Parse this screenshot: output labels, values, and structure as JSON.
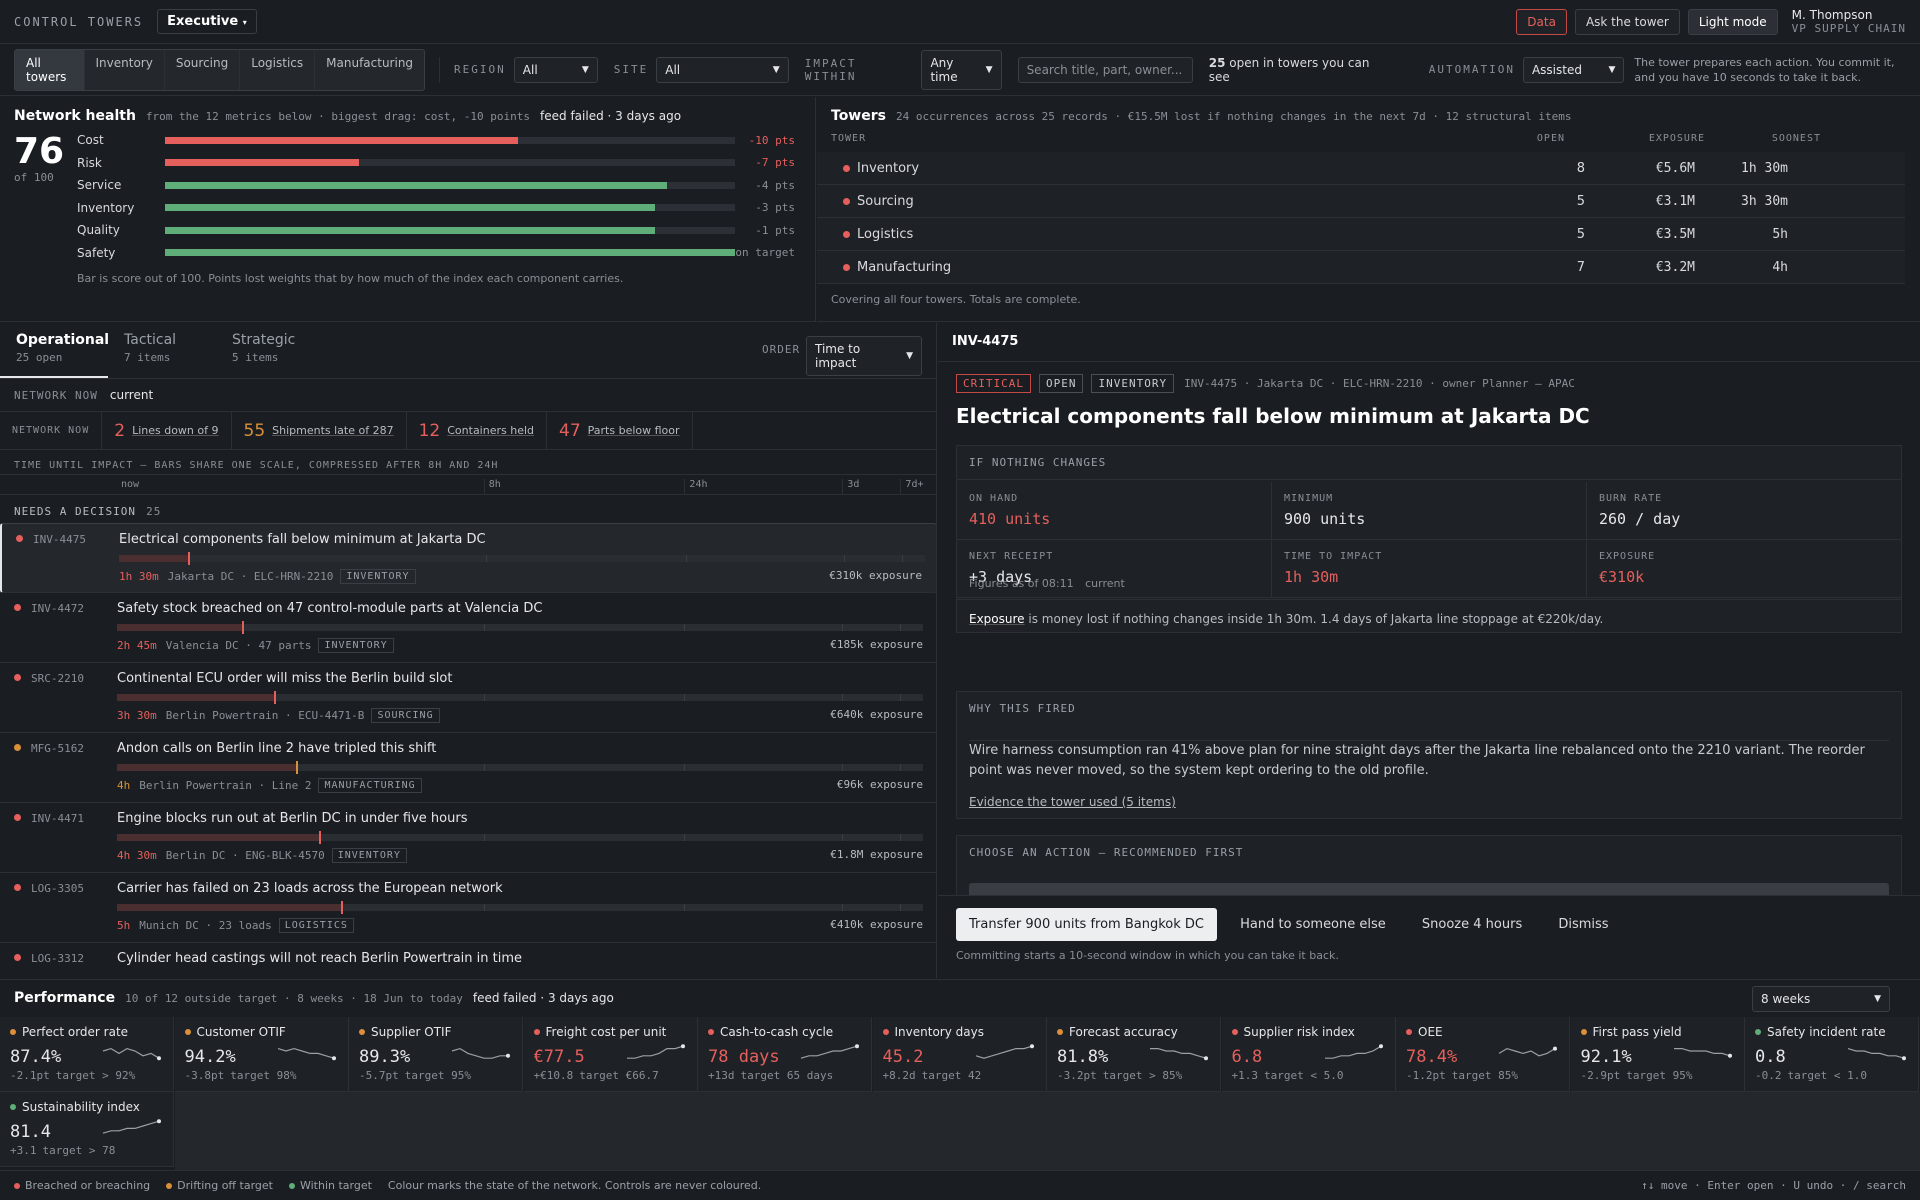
{
  "app": {
    "title": "CONTROL TOWERS",
    "scope": "Executive"
  },
  "top": {
    "data": "Data",
    "ask": "Ask the tower",
    "mode": "Light mode",
    "user_name": "M. Thompson",
    "user_role": "VP SUPPLY CHAIN"
  },
  "filters": {
    "towers": [
      "All towers",
      "Inventory",
      "Sourcing",
      "Logistics",
      "Manufacturing"
    ],
    "region_label": "REGION",
    "region": "All",
    "site_label": "SITE",
    "site": "All",
    "impact_label": "IMPACT WITHIN",
    "impact": "Any time",
    "search_placeholder": "Search title, part, owner...",
    "open_count": "25",
    "open_text": "open in towers you can see",
    "automation_label": "AUTOMATION",
    "automation": "Assisted",
    "automation_note": "The tower prepares each action. You commit it, and you have 10 seconds to take it back."
  },
  "health": {
    "title": "Network health",
    "subtitle": "from the 12 metrics below · biggest drag: cost, -10 points",
    "feed": "feed failed · 3 days ago",
    "score": "76",
    "of": "of 100",
    "note": "Bar is score out of 100. Points lost weights that by how much of the index each component carries.",
    "rows": [
      {
        "name": "Cost",
        "score": 62,
        "pts": "-10 pts",
        "status": "red"
      },
      {
        "name": "Risk",
        "score": 34,
        "pts": "-7 pts",
        "status": "red"
      },
      {
        "name": "Service",
        "score": 88,
        "pts": "-4 pts",
        "status": "green"
      },
      {
        "name": "Inventory",
        "score": 86,
        "pts": "-3 pts",
        "status": "green"
      },
      {
        "name": "Quality",
        "score": 86,
        "pts": "-1 pts",
        "status": "green"
      },
      {
        "name": "Safety",
        "score": 100,
        "pts": "on target",
        "status": "green"
      }
    ]
  },
  "towers": {
    "title": "Towers",
    "subtitle": "24 occurrences across 25 records · €15.5M lost if nothing changes in the next 7d · 12 structural items",
    "col_tower": "TOWER",
    "col_open": "OPEN",
    "col_exposure": "EXPOSURE",
    "col_soonest": "SOONEST",
    "footnote": "Covering all four towers. Totals are complete.",
    "rows": [
      {
        "name": "Inventory",
        "open": "8",
        "exposure": "€5.6M",
        "soonest": "1h 30m"
      },
      {
        "name": "Sourcing",
        "open": "5",
        "exposure": "€3.1M",
        "soonest": "3h 30m"
      },
      {
        "name": "Logistics",
        "open": "5",
        "exposure": "€3.5M",
        "soonest": "5h"
      },
      {
        "name": "Manufacturing",
        "open": "7",
        "exposure": "€3.2M",
        "soonest": "4h"
      }
    ]
  },
  "queue": {
    "tabs": [
      {
        "label": "Operational",
        "sub": "25 open"
      },
      {
        "label": "Tactical",
        "sub": "7 items"
      },
      {
        "label": "Strategic",
        "sub": "5 items"
      }
    ],
    "order_label": "ORDER",
    "order": "Time to impact",
    "netnow_label": "NETWORK NOW",
    "netnow_value": "current",
    "stats_label": "NETWORK NOW",
    "stats": [
      {
        "v": "2",
        "l": "Lines down of 9"
      },
      {
        "v": "55",
        "l": "Shipments late of 287"
      },
      {
        "v": "12",
        "l": "Containers held"
      },
      {
        "v": "47",
        "l": "Parts below floor"
      }
    ],
    "scale_caption": "TIME UNTIL IMPACT — BARS SHARE ONE SCALE, COMPRESSED AFTER 8H AND 24H",
    "scale_ticks": [
      "now",
      "8h",
      "24h",
      "3d",
      "7d+"
    ],
    "needs_label": "NEEDS A DECISION",
    "needs_count": "25",
    "items": [
      {
        "id": "INV-4475",
        "title": "Electrical components fall below minimum at Jakarta DC",
        "tti": "1h 30m",
        "meta": "Jakarta DC · ELC-HRN-2210",
        "tag": "INVENTORY",
        "exposure": "€310k exposure",
        "pos": 0.085,
        "status": "red"
      },
      {
        "id": "INV-4472",
        "title": "Safety stock breached on 47 control-module parts at Valencia DC",
        "tti": "2h 45m",
        "meta": "Valencia DC · 47 parts",
        "tag": "INVENTORY",
        "exposure": "€185k exposure",
        "pos": 0.155,
        "status": "red"
      },
      {
        "id": "SRC-2210",
        "title": "Continental ECU order will miss the Berlin build slot",
        "tti": "3h 30m",
        "meta": "Berlin Powertrain · ECU-4471-B",
        "tag": "SOURCING",
        "exposure": "€640k exposure",
        "pos": 0.195,
        "status": "red"
      },
      {
        "id": "MFG-5162",
        "title": "Andon calls on Berlin line 2 have tripled this shift",
        "tti": "4h",
        "meta": "Berlin Powertrain · Line 2",
        "tag": "MANUFACTURING",
        "exposure": "€96k exposure",
        "pos": 0.222,
        "status": "amber"
      },
      {
        "id": "INV-4471",
        "title": "Engine blocks run out at Berlin DC in under five hours",
        "tti": "4h 30m",
        "meta": "Berlin DC · ENG-BLK-4570",
        "tag": "INVENTORY",
        "exposure": "€1.8M exposure",
        "pos": 0.25,
        "status": "red"
      },
      {
        "id": "LOG-3305",
        "title": "Carrier has failed on 23 loads across the European network",
        "tti": "5h",
        "meta": "Munich DC · 23 loads",
        "tag": "LOGISTICS",
        "exposure": "€410k exposure",
        "pos": 0.278,
        "status": "red"
      },
      {
        "id": "LOG-3312",
        "title": "Cylinder head castings will not reach Berlin Powertrain in time",
        "tti": "",
        "meta": "",
        "tag": "",
        "exposure": "",
        "pos": 0.3,
        "status": "red"
      }
    ]
  },
  "detail": {
    "header": "INV-4475",
    "badges": [
      "CRITICAL",
      "OPEN",
      "INVENTORY"
    ],
    "meta": "INV-4475 · Jakarta DC · ELC-HRN-2210 · owner Planner — APAC",
    "title": "Electrical components fall below minimum at Jakarta DC",
    "if_label": "IF NOTHING CHANGES",
    "cells": [
      {
        "k": "ON HAND",
        "v": "410 units",
        "red": true
      },
      {
        "k": "MINIMUM",
        "v": "900 units",
        "red": false
      },
      {
        "k": "BURN RATE",
        "v": "260 / day",
        "red": false
      },
      {
        "k": "NEXT RECEIPT",
        "v": "+3 days",
        "red": false
      },
      {
        "k": "TIME TO IMPACT",
        "v": "1h 30m",
        "red": true
      },
      {
        "k": "EXPOSURE",
        "v": "€310k",
        "red": true
      }
    ],
    "figures": "Figures as of 08:11",
    "figures_state": "current",
    "exposure_word": "Exposure",
    "exposure_text": "is money lost if nothing changes inside 1h 30m. 1.4 days of Jakarta line stoppage at €220k/day.",
    "why_label": "WHY THIS FIRED",
    "why_text": "Wire harness consumption ran 41% above plan for nine straight days after the Jakarta line rebalanced onto the 2210 variant. The reorder point was never moved, so the system kept ordering to the old profile.",
    "evidence": "Evidence the tower used (5 items)",
    "choose_label": "CHOOSE AN ACTION — RECOMMENDED FIRST",
    "actions": [
      "Transfer 900 units from Bangkok DC",
      "Hand to someone else",
      "Snooze 4 hours",
      "Dismiss"
    ],
    "commit_note": "Committing starts a 10-second window in which you can take it back."
  },
  "perf": {
    "title": "Performance",
    "subtitle": "10 of 12 outside target · 8 weeks · 18 Jun to today",
    "feed": "feed failed · 3 days ago",
    "range": "8 weeks",
    "kpis": [
      {
        "name": "Perfect order rate",
        "value": "87.4%",
        "delta": "-2.1pt",
        "target": "target > 92%",
        "status": "amber",
        "trend": [
          5,
          6,
          4,
          6,
          5,
          3,
          4,
          2
        ]
      },
      {
        "name": "Customer OTIF",
        "value": "94.2%",
        "delta": "-3.8pt",
        "target": "target 98%",
        "status": "amber",
        "trend": [
          6,
          5,
          6,
          5,
          4,
          4,
          3,
          2
        ]
      },
      {
        "name": "Supplier OTIF",
        "value": "89.3%",
        "delta": "-5.7pt",
        "target": "target 95%",
        "status": "amber",
        "trend": [
          5,
          6,
          4,
          3,
          2,
          2,
          3,
          3
        ]
      },
      {
        "name": "Freight cost per unit",
        "value": "€77.5",
        "delta": "+€10.8",
        "target": "target €66.7",
        "status": "red",
        "trend": [
          2,
          2,
          3,
          3,
          4,
          6,
          6,
          7
        ]
      },
      {
        "name": "Cash-to-cash cycle",
        "value": "78 days",
        "delta": "+13d",
        "target": "target 65 days",
        "status": "red",
        "trend": [
          2,
          3,
          3,
          4,
          5,
          5,
          6,
          7
        ]
      },
      {
        "name": "Inventory days",
        "value": "45.2",
        "delta": "+8.2d",
        "target": "target 42",
        "status": "red",
        "trend": [
          3,
          2,
          3,
          4,
          5,
          6,
          6,
          7
        ]
      },
      {
        "name": "Forecast accuracy",
        "value": "81.8%",
        "delta": "-3.2pt",
        "target": "target > 85%",
        "status": "amber",
        "trend": [
          6,
          6,
          5,
          5,
          4,
          4,
          3,
          2
        ]
      },
      {
        "name": "Supplier risk index",
        "value": "6.8",
        "delta": "+1.3",
        "target": "target < 5.0",
        "status": "red",
        "trend": [
          2,
          2,
          3,
          3,
          4,
          4,
          5,
          7
        ]
      },
      {
        "name": "OEE",
        "value": "78.4%",
        "delta": "-1.2pt",
        "target": "target 85%",
        "status": "red",
        "trend": [
          4,
          6,
          5,
          4,
          5,
          3,
          4,
          6
        ]
      },
      {
        "name": "First pass yield",
        "value": "92.1%",
        "delta": "-2.9pt",
        "target": "target 95%",
        "status": "amber",
        "trend": [
          6,
          6,
          5,
          5,
          5,
          4,
          4,
          3
        ]
      },
      {
        "name": "Safety incident rate",
        "value": "0.8",
        "delta": "-0.2",
        "target": "target < 1.0",
        "status": "green",
        "trend": [
          6,
          5,
          5,
          4,
          4,
          3,
          3,
          2
        ]
      },
      {
        "name": "Sustainability index",
        "value": "81.4",
        "delta": "+3.1",
        "target": "target > 78",
        "status": "green",
        "trend": [
          2,
          3,
          3,
          4,
          4,
          5,
          6,
          7
        ]
      }
    ]
  },
  "footer": {
    "legend": [
      {
        "label": "Breached or breaching",
        "status": "red"
      },
      {
        "label": "Drifting off target",
        "status": "amber"
      },
      {
        "label": "Within target",
        "status": "green"
      }
    ],
    "note": "Colour marks the state of the network. Controls are never coloured.",
    "keys": "↑↓ move · Enter open · U undo · / search"
  },
  "colors": {
    "red": "#e5605d",
    "amber": "#d9903a",
    "green": "#5fae7a"
  }
}
